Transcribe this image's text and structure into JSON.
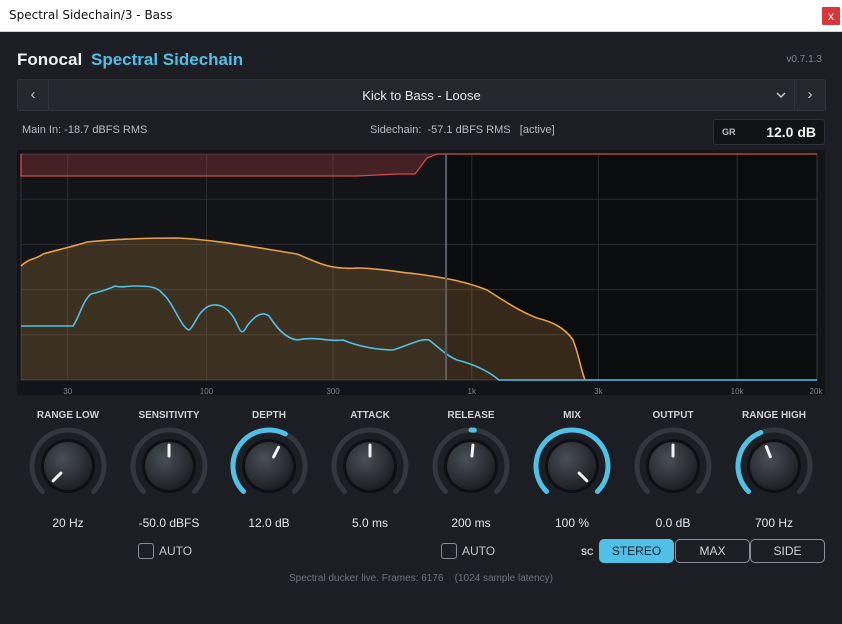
{
  "window": {
    "title": "Spectral Sidechain/3 - Bass",
    "close_glyph": "x"
  },
  "header": {
    "brand": "Fonocal",
    "product": "Spectral Sidechain",
    "version": "v0.7.1.3"
  },
  "preset": {
    "name": "Kick to Bass - Loose",
    "prev_icon": "chevron-left-icon",
    "next_icon": "chevron-right-icon",
    "dropdown_icon": "chevron-down-icon"
  },
  "meters": {
    "main_in": "Main In:  -18.7 dBFS RMS",
    "sidechain": "Sidechain:  -57.1 dBFS RMS   [active]"
  },
  "gain_reduction": {
    "label": "GR",
    "value": "12.0 dB"
  },
  "spectrum": {
    "axis_labels": [
      "30",
      "100",
      "300",
      "1k",
      "3k",
      "10k",
      "20k"
    ],
    "colors": {
      "reduction": "#d8474b",
      "main": "#e8a04a",
      "sidechain": "#4fc0e6"
    },
    "split_hz": 800
  },
  "knobs": [
    {
      "label": "RANGE LOW",
      "value": "20 Hz",
      "level": 0.0
    },
    {
      "label": "SENSITIVITY",
      "value": "-50.0 dBFS",
      "level": 0.5
    },
    {
      "label": "DEPTH",
      "value": "12.0 dB",
      "level": 0.6
    },
    {
      "label": "ATTACK",
      "value": "5.0 ms",
      "level": 0.5
    },
    {
      "label": "RELEASE",
      "value": "200 ms",
      "level": 0.52
    },
    {
      "label": "MIX",
      "value": "100 %",
      "level": 1.0
    },
    {
      "label": "OUTPUT",
      "value": "0.0 dB",
      "level": 0.5
    },
    {
      "label": "RANGE HIGH",
      "value": "700 Hz",
      "level": 0.42
    }
  ],
  "auto_sensitivity": {
    "label": "AUTO",
    "checked": false
  },
  "auto_release": {
    "label": "AUTO",
    "checked": false
  },
  "sidechain_mode": {
    "label": "SC",
    "options": [
      "STEREO",
      "MAX",
      "SIDE"
    ],
    "selected": "STEREO"
  },
  "status": "Spectral ducker live. Frames: 6176    (1024 sample latency)"
}
